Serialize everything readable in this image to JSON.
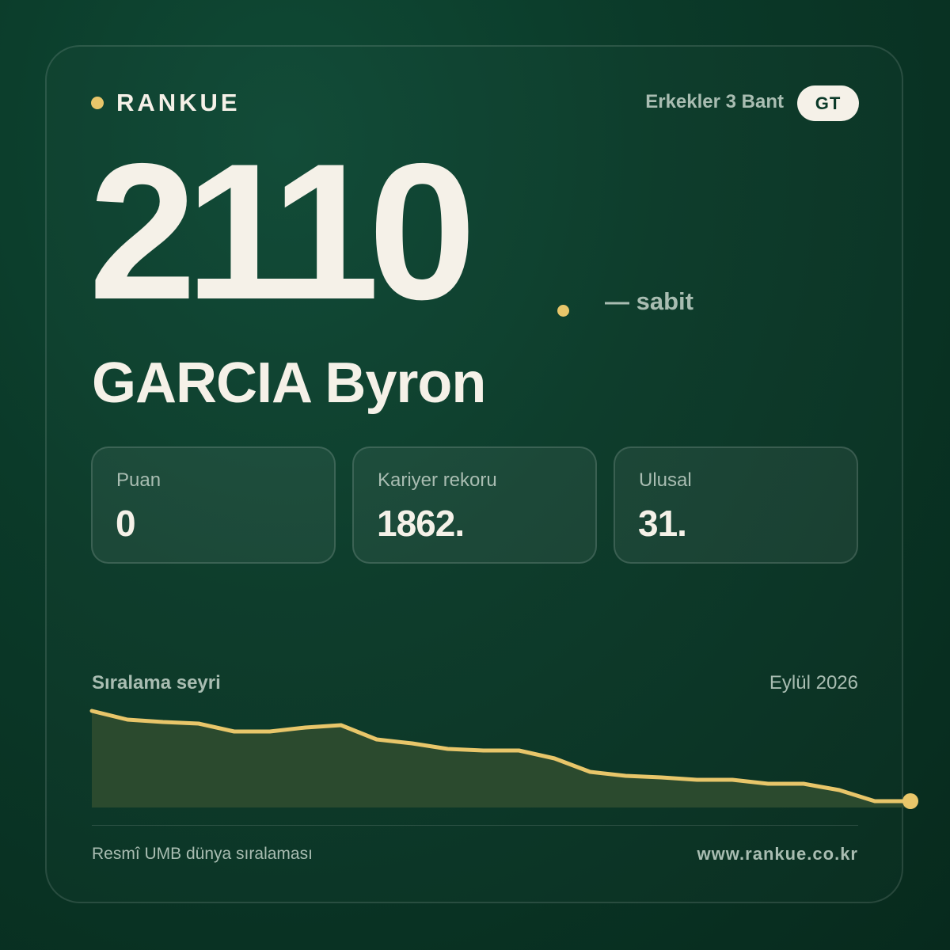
{
  "brand": {
    "name": "RANKUE",
    "accent_color": "#e8c66a"
  },
  "header": {
    "category": "Erkekler 3 Bant",
    "country_code": "GT"
  },
  "rank": {
    "value": "2110",
    "change": "— sabit"
  },
  "player": {
    "name": "GARCIA Byron"
  },
  "stats": [
    {
      "label": "Puan",
      "value": "0"
    },
    {
      "label": "Kariyer rekoru",
      "value": "1862."
    },
    {
      "label": "Ulusal",
      "value": "31."
    }
  ],
  "trend": {
    "title": "Sıralama seyri",
    "date": "Eylül 2026"
  },
  "chart_data": {
    "type": "area",
    "line_color": "#e8c66a",
    "fill_color": "#2b4a2e",
    "values": [
      0,
      11,
      14,
      16,
      26,
      26,
      21,
      18,
      36,
      41,
      48,
      50,
      50,
      60,
      77,
      82,
      84,
      87,
      87,
      92,
      92,
      100,
      114,
      114
    ]
  },
  "footer": {
    "source": "Resmî UMB dünya sıralaması",
    "url": "www.rankue.co.kr"
  }
}
